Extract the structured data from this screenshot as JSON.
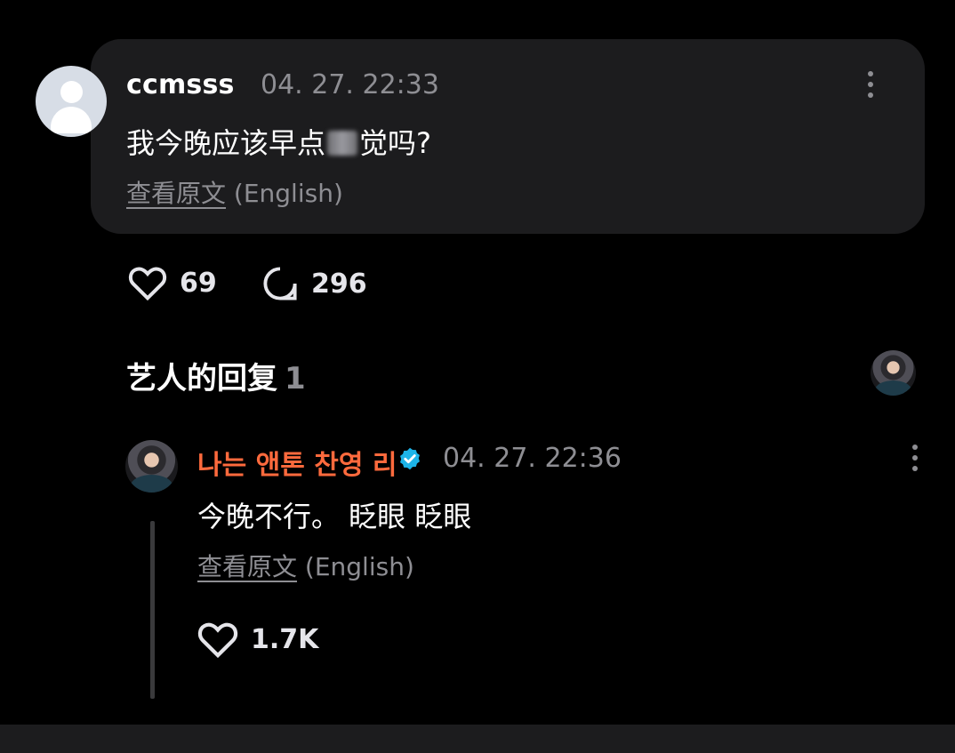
{
  "comment": {
    "author": "ccmsss",
    "timestamp": "04. 27. 22:33",
    "text_before": "我今晚应该早点",
    "text_after": "觉吗?",
    "view_original": "查看原文",
    "view_original_lang": "(English)",
    "likes": "69",
    "replies": "296"
  },
  "artist_replies": {
    "title": "艺人的回复",
    "count": "1"
  },
  "reply": {
    "author": "나는 앤톤 찬영 리",
    "timestamp": "04. 27. 22:36",
    "text": "今晚不行。 眨眼 眨眼",
    "view_original": "查看原文",
    "view_original_lang": "(English)",
    "likes": "1.7K"
  },
  "colors": {
    "artist_name": "#ff6a3d",
    "verified": "#1db4e8",
    "card_bg": "#1c1c1e",
    "muted_text": "#8e8e93"
  }
}
